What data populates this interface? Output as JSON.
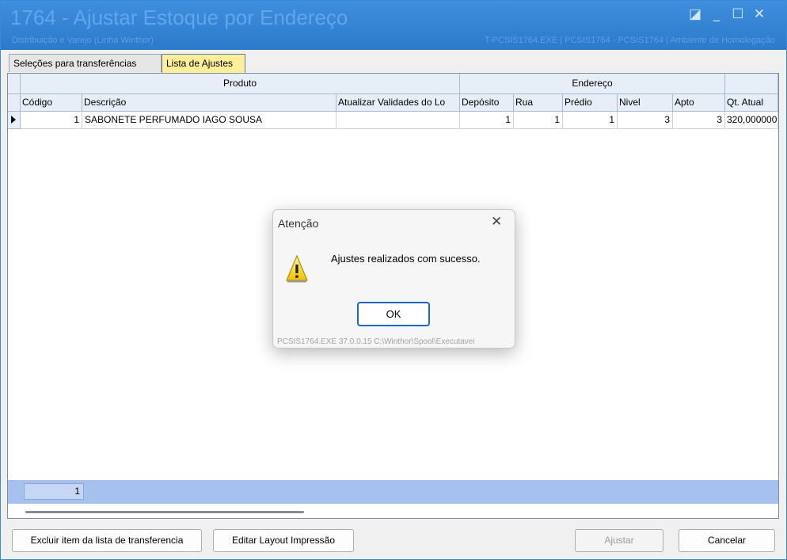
{
  "window": {
    "title": "1764 - Ajustar Estoque por Endereço",
    "subtitle": "Distribuição e Varejo (Linha Winthor)",
    "info": "T-PCSIS1764.EXE | PCSIS1764 - PCSIS1764 | Ambiente de Homologação",
    "controls": {
      "restore_icon": "◪",
      "minimize_icon": "_",
      "maximize_icon": "☐",
      "close_icon": "✕"
    }
  },
  "tabs": [
    {
      "label": "Seleções para transferências",
      "active": false
    },
    {
      "label": "Lista de Ajustes",
      "active": true
    }
  ],
  "grid": {
    "groups": {
      "produto": "Produto",
      "endereco": "Endereço"
    },
    "columns": {
      "codigo": "Código",
      "descricao": "Descrição",
      "atualizar": "Atualizar Validades do Lo",
      "deposito": "Depósito",
      "rua": "Rua",
      "predio": "Prédio",
      "nivel": "Nivel",
      "apto": "Apto",
      "qt_atual": "Qt. Atual"
    },
    "rows": [
      {
        "codigo": "1",
        "descricao": "SABONETE PERFUMADO IAGO SOUSA",
        "atualizar": "",
        "deposito": "1",
        "rua": "1",
        "predio": "1",
        "nivel": "3",
        "apto": "3",
        "qt_atual": "320,000000"
      }
    ],
    "footer_count": "1"
  },
  "buttons": {
    "excluir": "Excluir item da lista de transferencia",
    "editar_layout": "Editar Layout Impressão",
    "ajustar": "Ajustar",
    "cancelar": "Cancelar"
  },
  "dialog": {
    "title": "Atenção",
    "close_icon": "✕",
    "icon": "warning-icon",
    "message": "Ajustes realizados com sucesso.",
    "ok_label": "OK",
    "path": "PCSIS1764.EXE 37.0.0.15 C:\\Winthor\\Spool\\Executavei"
  },
  "colors": {
    "titlebar": "#3b8ad6",
    "active_tab": "#ffef9a",
    "footer_bar": "#a6c1ee",
    "dialog_ok_border": "#1a66c9"
  }
}
